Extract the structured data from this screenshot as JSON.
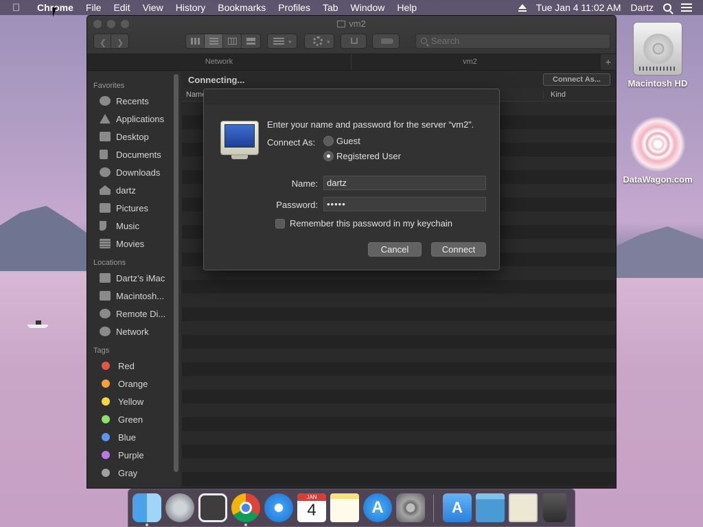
{
  "menubar": {
    "app": "Chrome",
    "items": [
      "File",
      "Edit",
      "View",
      "History",
      "Bookmarks",
      "Profiles",
      "Tab",
      "Window",
      "Help"
    ],
    "clock": "Tue Jan 4  11:02 AM",
    "user": "Dartz"
  },
  "desktop": {
    "icons": [
      {
        "label": "Macintosh HD"
      },
      {
        "label": "DataWagon.com"
      }
    ]
  },
  "finder": {
    "title": "vm2",
    "search_placeholder": "Search",
    "tabs": [
      {
        "label": "Network"
      },
      {
        "label": "vm2"
      }
    ],
    "tab_add": "+",
    "status": "Connecting...",
    "connect_as_button": "Connect As...",
    "columns": {
      "name": "Name",
      "kind": "Kind"
    },
    "sidebar": {
      "favorites_header": "Favorites",
      "favorites": [
        "Recents",
        "Applications",
        "Desktop",
        "Documents",
        "Downloads",
        "dartz",
        "Pictures",
        "Music",
        "Movies"
      ],
      "locations_header": "Locations",
      "locations": [
        "Dartz’s iMac",
        "Macintosh...",
        "Remote Di...",
        "Network"
      ],
      "tags_header": "Tags",
      "tags": [
        {
          "label": "Red",
          "color": "#e5534b"
        },
        {
          "label": "Orange",
          "color": "#f0a13c"
        },
        {
          "label": "Yellow",
          "color": "#f5d93a"
        },
        {
          "label": "Green",
          "color": "#8ee06b"
        },
        {
          "label": "Blue",
          "color": "#5c94f0"
        },
        {
          "label": "Purple",
          "color": "#b977e8"
        },
        {
          "label": "Gray",
          "color": "#a0a0a0"
        }
      ]
    }
  },
  "dialog": {
    "message": "Enter your name and password for the server “vm2”.",
    "connect_as_label": "Connect As:",
    "radio_guest": "Guest",
    "radio_registered": "Registered User",
    "selected": "Registered User",
    "name_label": "Name:",
    "name_value": "dartz",
    "password_label": "Password:",
    "password_value": "•••••",
    "remember_label": "Remember this password in my keychain",
    "remember_checked": false,
    "cancel_button": "Cancel",
    "connect_button": "Connect"
  },
  "dock": {
    "calendar_month": "JAN",
    "calendar_day": "4",
    "items": [
      "finder-icon",
      "launchpad-icon",
      "photo-browser-icon",
      "chrome-icon",
      "safari-icon",
      "calendar-icon",
      "notes-icon",
      "app-store-icon",
      "system-preferences-icon",
      "applications-folder-icon",
      "folder-icon",
      "preview-icon",
      "trash-icon"
    ]
  }
}
